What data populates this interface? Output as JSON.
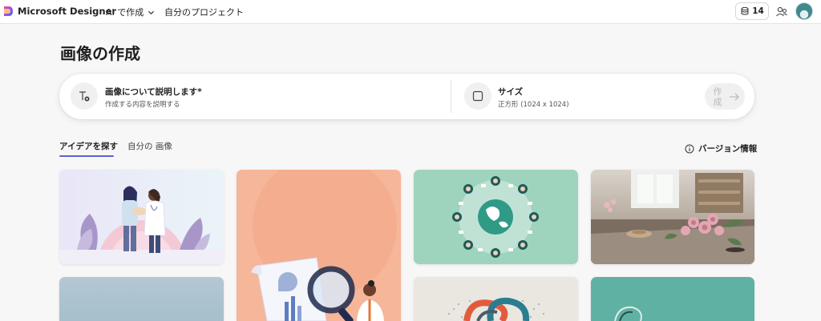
{
  "header": {
    "brand": "Microsoft Designer",
    "nav_ai": "AI で作成",
    "nav_projects": "自分のプロジェクト",
    "credits": "14"
  },
  "page": {
    "title": "画像の作成"
  },
  "prompt": {
    "describe_title": "画像について説明します",
    "describe_required": "*",
    "describe_placeholder": "作成する内容を説明する",
    "size_title": "サイズ",
    "size_value": "正方形 (1024 x 1024)",
    "create_label": "作成"
  },
  "tabs": [
    {
      "label": "アイデアを探す",
      "active": true
    },
    {
      "label": "自分の 画像",
      "active": false
    }
  ],
  "version_info": "バージョン情報",
  "icons": {
    "logo": "designer-logo-icon",
    "chevron": "chevron-down-icon",
    "credits": "coin-stack-icon",
    "share": "people-icon",
    "describe": "text-edit-icon",
    "size": "square-icon",
    "arrow": "arrow-right-icon",
    "info": "info-icon"
  },
  "colors": {
    "accent": "#5a63d8",
    "background": "#f7f7f7"
  }
}
